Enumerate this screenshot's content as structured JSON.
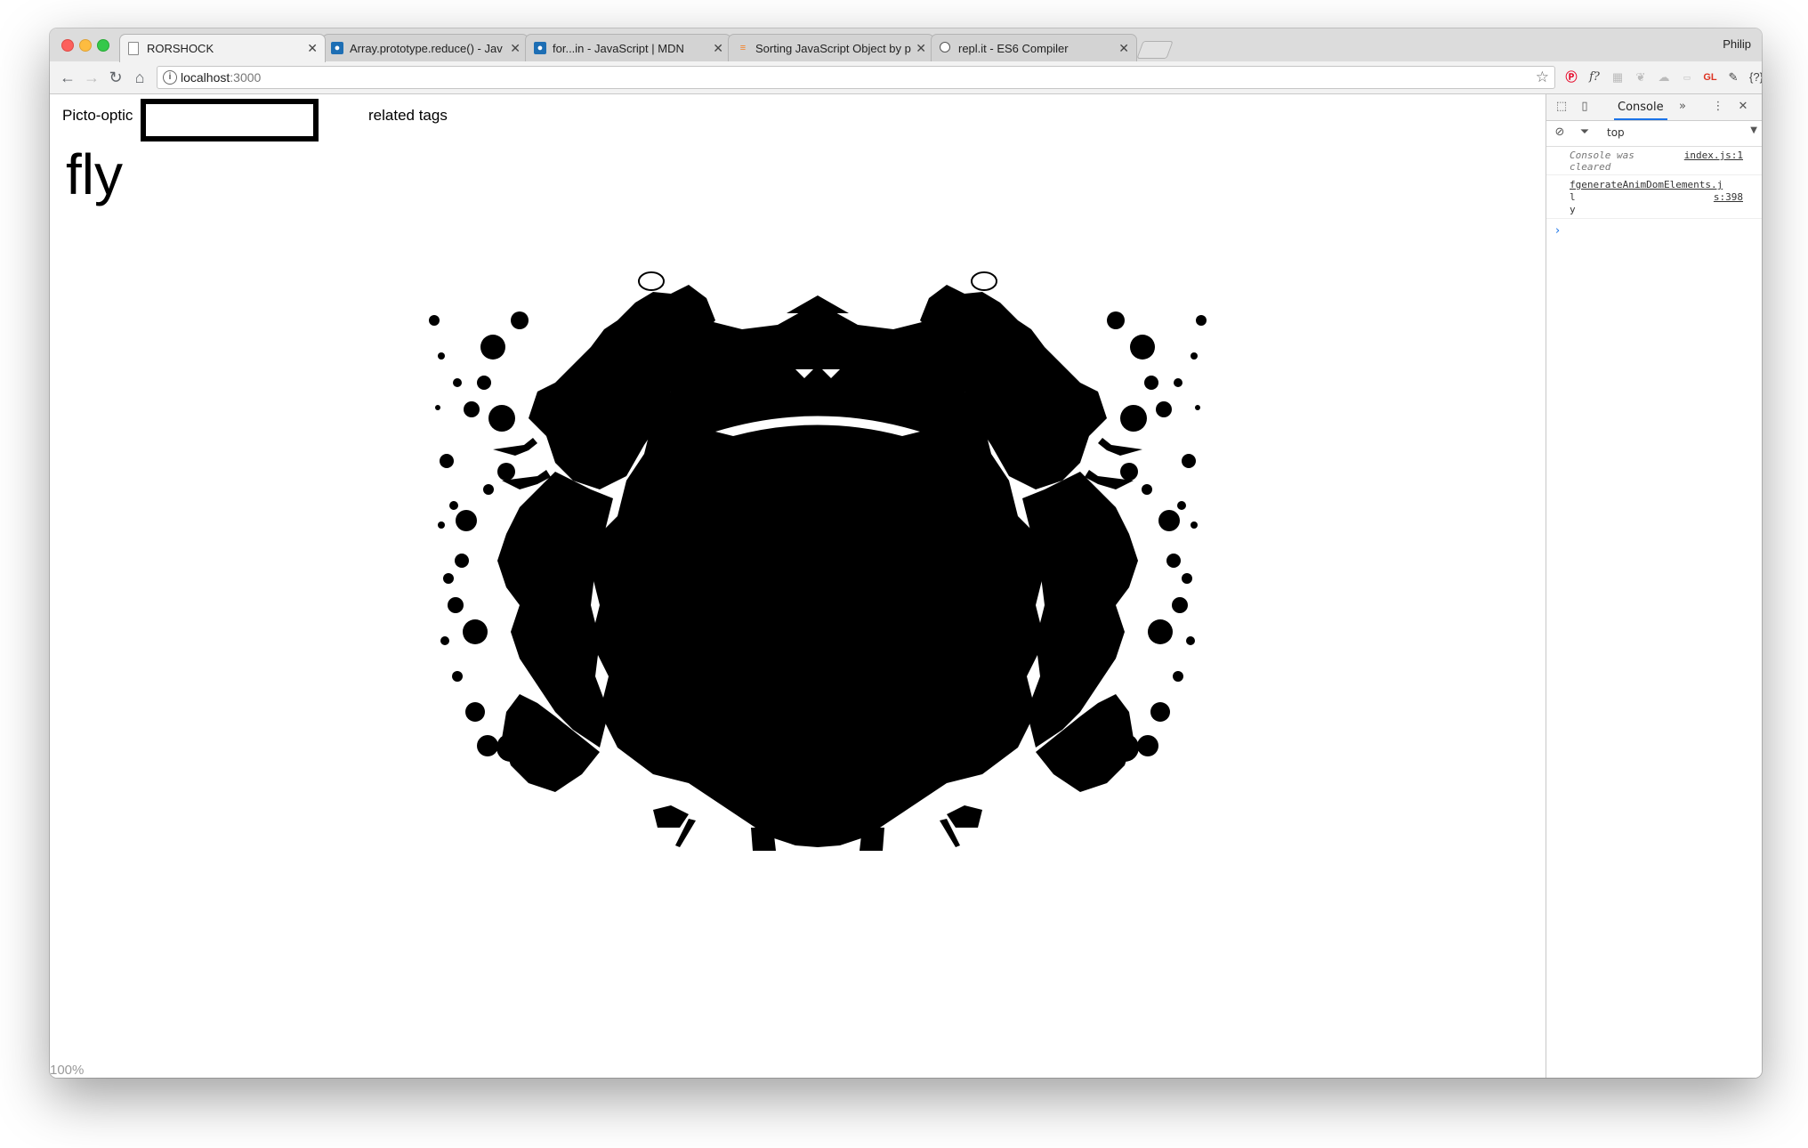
{
  "browser": {
    "tabs": [
      {
        "title": "RORSHOCK",
        "favicon": "page-icon"
      },
      {
        "title": "Array.prototype.reduce() - Jav",
        "favicon": "mdn-icon"
      },
      {
        "title": "for...in - JavaScript | MDN",
        "favicon": "mdn-icon"
      },
      {
        "title": "Sorting JavaScript Object by p",
        "favicon": "stackoverflow-icon"
      },
      {
        "title": "repl.it - ES6 Compiler",
        "favicon": "replit-icon"
      }
    ],
    "profile_name": "Philip",
    "url_host": "localhost",
    "url_port": ":3000",
    "extensions": [
      "pinterest-icon",
      "function-icon",
      "qr-icon",
      "leaf-icon",
      "cloud-icon",
      "ext-icon",
      "gl-icon",
      "eyedropper-icon",
      "json-icon",
      "menu-icon"
    ]
  },
  "page": {
    "site_title": "Picto-optic",
    "search_value": "",
    "related_tags_label": "related tags",
    "query_word": "fly",
    "zoom_label": "100%"
  },
  "devtools": {
    "active_tab": "Console",
    "context": "top",
    "logs": [
      {
        "message": "Console was cleared",
        "source": "index.js:1"
      },
      {
        "message": "fgenerateAnimDomElements.j",
        "message2": "l",
        "message3": "y",
        "source": "s:398"
      }
    ],
    "colors": {
      "accent": "#1a73e8"
    }
  }
}
